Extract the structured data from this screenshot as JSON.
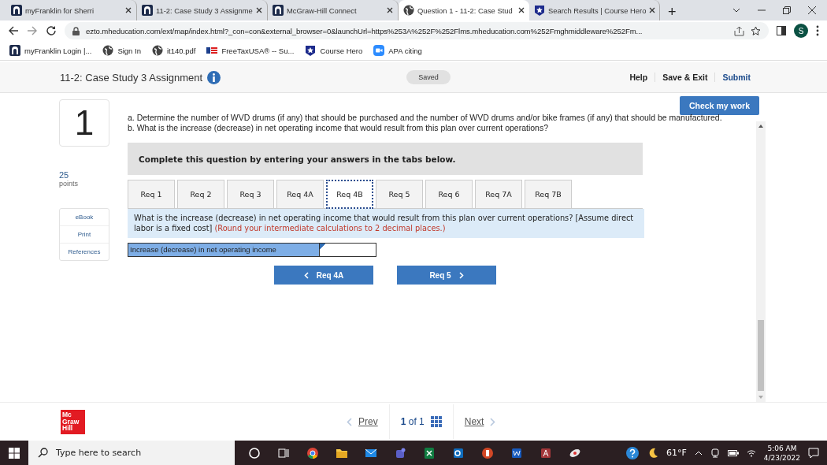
{
  "browser": {
    "tabs": [
      {
        "title": "myFranklin for Sherri",
        "kind": "franklin",
        "selected": false
      },
      {
        "title": "11-2: Case Study 3 Assignme",
        "kind": "franklin",
        "selected": false
      },
      {
        "title": "McGraw-Hill Connect",
        "kind": "franklin",
        "selected": false
      },
      {
        "title": "Question 1 - 11-2: Case Stud",
        "kind": "globe",
        "selected": true
      },
      {
        "title": "Search Results | Course Hero",
        "kind": "hero",
        "selected": false
      }
    ],
    "new_tab": "+",
    "address": "ezto.mheducation.com/ext/map/index.html?_con=con&external_browser=0&launchUrl=https%253A%252F%252Flms.mheducation.com%252Fmghmiddleware%252Fm...",
    "profile": "S",
    "bookmarks": [
      {
        "label": "myFranklin Login |...",
        "kind": "franklin"
      },
      {
        "label": "Sign In",
        "kind": "globe"
      },
      {
        "label": "it140.pdf",
        "kind": "globe"
      },
      {
        "label": "FreeTaxUSA® -- Su...",
        "kind": "flag"
      },
      {
        "label": "Course Hero",
        "kind": "hero"
      },
      {
        "label": "APA citing",
        "kind": "video"
      }
    ]
  },
  "header": {
    "title": "11-2: Case Study 3 Assignment",
    "status": "Saved",
    "links": [
      "Help",
      "Save & Exit",
      "Submit"
    ]
  },
  "check_button": "Check my work",
  "question": {
    "number": "1",
    "points": "25",
    "points_label": "points",
    "tools": [
      "eBook",
      "Print",
      "References"
    ],
    "text_lines": [
      "a. Determine the number of WVD drums (if any) that should be purchased and the number of WVD drums and/or bike frames (if any) that should be manufactured.",
      "b. What is the increase (decrease) in net operating income that would result from this plan over current operations?"
    ],
    "instructions": "Complete this question by entering your answers in the tabs below.",
    "tabs": [
      {
        "label": "Req 1",
        "selected": false
      },
      {
        "label": "Req 2",
        "selected": false
      },
      {
        "label": "Req 3",
        "selected": false
      },
      {
        "label": "Req 4A",
        "selected": false
      },
      {
        "label": "Req 4B",
        "selected": true
      },
      {
        "label": "Req 5",
        "selected": false
      },
      {
        "label": "Req 6",
        "selected": false
      },
      {
        "label": "Req 7A",
        "selected": false
      },
      {
        "label": "Req 7B",
        "selected": false
      }
    ],
    "prompt": "What is the increase (decrease) in net operating income that would result from this plan over current operations? [Assume direct labor is a fixed cost]",
    "prompt_note": "(Round your intermediate calculations to 2 decimal places.)",
    "answer_label": "Increase (decrease) in net operating income",
    "prev_button": "Req 4A",
    "next_button": "Req 5"
  },
  "footer": {
    "logo_lines": [
      "Mc",
      "Graw",
      "Hill"
    ],
    "prev": "Prev",
    "page": "**1** of 1",
    "next": "Next"
  },
  "taskbar": {
    "search_placeholder": "Type here to search",
    "weather": "61°F",
    "time": "5:06 AM",
    "date": "4/23/2022"
  }
}
